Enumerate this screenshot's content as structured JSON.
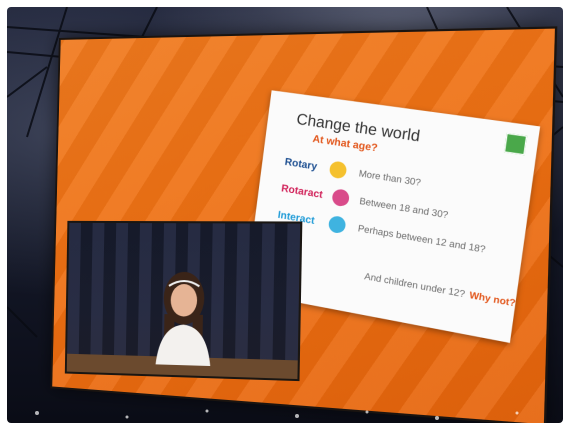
{
  "slide": {
    "title": "Change the world",
    "subtitle": "At what age?",
    "clubs": [
      {
        "name": "Rotary",
        "name_color": "#1d4f91",
        "wheel_color": "#f5c12e",
        "answer": "More than 30?"
      },
      {
        "name": "Rotaract",
        "name_color": "#d1225a",
        "wheel_color": "#d94b8a",
        "answer": "Between 18 and 30?"
      },
      {
        "name": "Interact",
        "name_color": "#1f9bd7",
        "wheel_color": "#3fb3e0",
        "answer": "Perhaps between 12 and 18?"
      }
    ],
    "closing": "And children under 12?",
    "closing_emphasis": "Why not?"
  },
  "colors": {
    "screen_orange": "#ef7419",
    "accent_red": "#e2561b"
  }
}
